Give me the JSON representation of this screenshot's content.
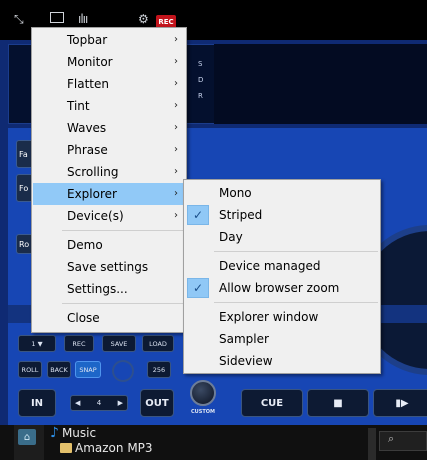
{
  "topbar": {
    "rec_badge": "REC",
    "icons": [
      "move-icon",
      "window-icon",
      "waveform-icon",
      "gear-icon"
    ]
  },
  "deck": {
    "sdr": [
      "S",
      "D",
      "R"
    ],
    "side_buttons": [
      "Fa",
      "Fo",
      "Ro"
    ],
    "small_buttons": {
      "deck_select": "1 ▼",
      "rec": "REC",
      "save": "SAVE",
      "load": "LOAD",
      "roll": "ROLL",
      "back": "BACK",
      "snap": "SNAP",
      "bpm": "256"
    },
    "in": "IN",
    "out": "OUT",
    "loop_value": "4",
    "loop_left": "◀",
    "loop_right": "▶",
    "knob_label": "CUSTOM",
    "cue": "CUE",
    "stop": "■",
    "play": "▮▶"
  },
  "browser": {
    "items": [
      {
        "label": "Music",
        "icon": "music-note-icon"
      },
      {
        "label": "Amazon MP3",
        "icon": "folder-icon"
      }
    ],
    "search_icon": "⌕"
  },
  "main_menu": {
    "items": [
      {
        "label": "Topbar",
        "submenu": true,
        "highlighted": false
      },
      {
        "label": "Monitor",
        "submenu": true,
        "highlighted": false
      },
      {
        "label": "Flatten",
        "submenu": true,
        "highlighted": false
      },
      {
        "label": "Tint",
        "submenu": true,
        "highlighted": false
      },
      {
        "label": "Waves",
        "submenu": true,
        "highlighted": false
      },
      {
        "label": "Phrase",
        "submenu": true,
        "highlighted": false
      },
      {
        "label": "Scrolling",
        "submenu": true,
        "highlighted": false
      },
      {
        "label": "Explorer",
        "submenu": true,
        "highlighted": true
      },
      {
        "label": "Device(s)",
        "submenu": true,
        "highlighted": false
      },
      {
        "label": "Demo",
        "submenu": false,
        "highlighted": false
      },
      {
        "label": "Save settings",
        "submenu": false,
        "highlighted": false
      },
      {
        "label": "Settings...",
        "submenu": false,
        "highlighted": false
      },
      {
        "label": "Close",
        "submenu": false,
        "highlighted": false
      }
    ],
    "arrow": "›"
  },
  "explorer_menu": {
    "items": [
      {
        "label": "Mono",
        "checked": false
      },
      {
        "label": "Striped",
        "checked": true
      },
      {
        "label": "Day",
        "checked": false
      },
      {
        "label": "Device managed",
        "checked": false
      },
      {
        "label": "Allow browser zoom",
        "checked": true
      },
      {
        "label": "Explorer window",
        "checked": false
      },
      {
        "label": "Sampler",
        "checked": false
      },
      {
        "label": "Sideview",
        "checked": false
      }
    ],
    "check_mark": "✓"
  },
  "colors": {
    "menu_bg": "#f0f0f0",
    "highlight": "#91c9f7",
    "deck_blue": "#1746b4",
    "rec_red": "#c3141c"
  }
}
